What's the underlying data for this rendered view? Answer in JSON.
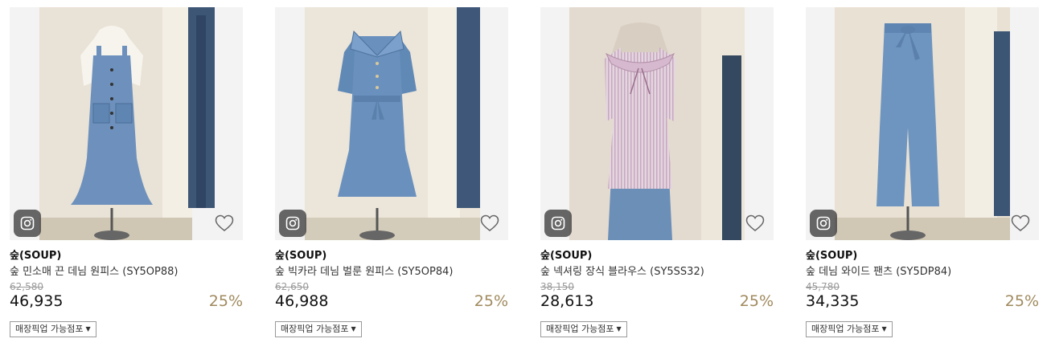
{
  "products": [
    {
      "brand": "숲(SOUP)",
      "name": "숲 민소매 끈 데님 원피스 (SY5OP88)",
      "original_price": "62,580",
      "price": "46,935",
      "discount": "25%",
      "pickup_label": "매장픽업 가능점포",
      "icons": [
        "instagram-icon",
        "heart-icon",
        "chevron-down-icon"
      ]
    },
    {
      "brand": "숲(SOUP)",
      "name": "숲 빅카라 데님 벌룬 원피스 (SY5OP84)",
      "original_price": "62,650",
      "price": "46,988",
      "discount": "25%",
      "pickup_label": "매장픽업 가능점포",
      "icons": [
        "instagram-icon",
        "heart-icon",
        "chevron-down-icon"
      ]
    },
    {
      "brand": "숲(SOUP)",
      "name": "숲 넥셔링 장식 블라우스 (SY5SS32)",
      "original_price": "38,150",
      "price": "28,613",
      "discount": "25%",
      "pickup_label": "매장픽업 가능점포",
      "icons": [
        "instagram-icon",
        "heart-icon",
        "chevron-down-icon"
      ]
    },
    {
      "brand": "숲(SOUP)",
      "name": "숲 데님 와이드 팬츠 (SY5DP84)",
      "original_price": "45,780",
      "price": "34,335",
      "discount": "25%",
      "pickup_label": "매장픽업 가능점포",
      "icons": [
        "instagram-icon",
        "heart-icon",
        "chevron-down-icon"
      ]
    }
  ],
  "colors": {
    "discount": "#a08a5e",
    "strike_price": "#9a9a9a",
    "denim": "#5f86b3",
    "lilac_stripe": "#c9a7c0"
  }
}
